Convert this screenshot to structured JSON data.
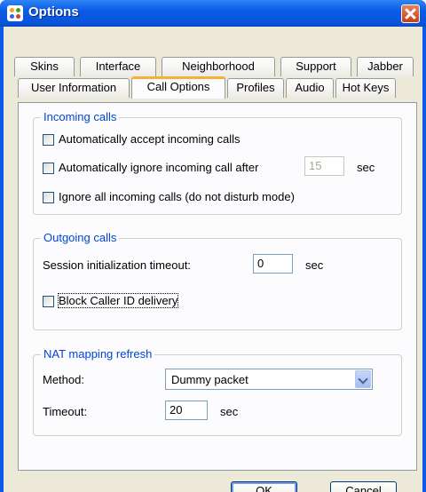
{
  "window": {
    "title": "Options"
  },
  "tabs": {
    "row_back": [
      "Skins",
      "Interface",
      "Neighborhood",
      "Support",
      "Jabber"
    ],
    "row_front": [
      "User Information",
      "Call Options",
      "Profiles",
      "Audio",
      "Hot Keys"
    ],
    "active": "Call Options"
  },
  "incoming": {
    "title": "Incoming calls",
    "auto_accept": {
      "label": "Automatically accept incoming calls",
      "checked": false
    },
    "auto_ignore": {
      "label": "Automatically ignore incoming call after",
      "checked": false,
      "value": "15",
      "unit": "sec"
    },
    "ignore_all": {
      "label": "Ignore all incoming calls (do not disturb mode)",
      "checked": false
    }
  },
  "outgoing": {
    "title": "Outgoing calls",
    "session_timeout": {
      "label": "Session initialization timeout:",
      "value": "0",
      "unit": "sec"
    },
    "block_caller_id": {
      "label": "Block Caller ID delivery",
      "checked": false
    }
  },
  "nat": {
    "title": "NAT mapping refresh",
    "method": {
      "label": "Method:",
      "value": "Dummy packet"
    },
    "timeout": {
      "label": "Timeout:",
      "value": "20",
      "unit": "sec"
    }
  },
  "buttons": {
    "ok": "OK",
    "cancel": "Cancel"
  }
}
